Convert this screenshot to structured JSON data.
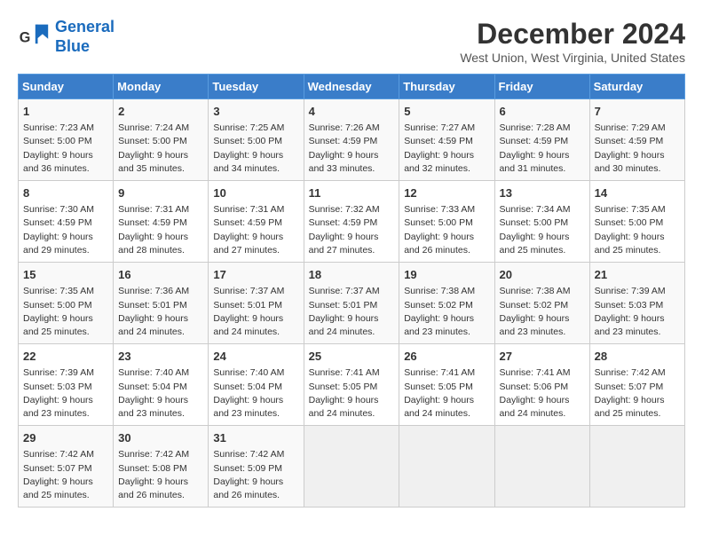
{
  "logo": {
    "line1": "General",
    "line2": "Blue"
  },
  "title": "December 2024",
  "location": "West Union, West Virginia, United States",
  "days_header": [
    "Sunday",
    "Monday",
    "Tuesday",
    "Wednesday",
    "Thursday",
    "Friday",
    "Saturday"
  ],
  "weeks": [
    [
      {
        "day": "1",
        "info": "Sunrise: 7:23 AM\nSunset: 5:00 PM\nDaylight: 9 hours\nand 36 minutes."
      },
      {
        "day": "2",
        "info": "Sunrise: 7:24 AM\nSunset: 5:00 PM\nDaylight: 9 hours\nand 35 minutes."
      },
      {
        "day": "3",
        "info": "Sunrise: 7:25 AM\nSunset: 5:00 PM\nDaylight: 9 hours\nand 34 minutes."
      },
      {
        "day": "4",
        "info": "Sunrise: 7:26 AM\nSunset: 4:59 PM\nDaylight: 9 hours\nand 33 minutes."
      },
      {
        "day": "5",
        "info": "Sunrise: 7:27 AM\nSunset: 4:59 PM\nDaylight: 9 hours\nand 32 minutes."
      },
      {
        "day": "6",
        "info": "Sunrise: 7:28 AM\nSunset: 4:59 PM\nDaylight: 9 hours\nand 31 minutes."
      },
      {
        "day": "7",
        "info": "Sunrise: 7:29 AM\nSunset: 4:59 PM\nDaylight: 9 hours\nand 30 minutes."
      }
    ],
    [
      {
        "day": "8",
        "info": "Sunrise: 7:30 AM\nSunset: 4:59 PM\nDaylight: 9 hours\nand 29 minutes."
      },
      {
        "day": "9",
        "info": "Sunrise: 7:31 AM\nSunset: 4:59 PM\nDaylight: 9 hours\nand 28 minutes."
      },
      {
        "day": "10",
        "info": "Sunrise: 7:31 AM\nSunset: 4:59 PM\nDaylight: 9 hours\nand 27 minutes."
      },
      {
        "day": "11",
        "info": "Sunrise: 7:32 AM\nSunset: 4:59 PM\nDaylight: 9 hours\nand 27 minutes."
      },
      {
        "day": "12",
        "info": "Sunrise: 7:33 AM\nSunset: 5:00 PM\nDaylight: 9 hours\nand 26 minutes."
      },
      {
        "day": "13",
        "info": "Sunrise: 7:34 AM\nSunset: 5:00 PM\nDaylight: 9 hours\nand 25 minutes."
      },
      {
        "day": "14",
        "info": "Sunrise: 7:35 AM\nSunset: 5:00 PM\nDaylight: 9 hours\nand 25 minutes."
      }
    ],
    [
      {
        "day": "15",
        "info": "Sunrise: 7:35 AM\nSunset: 5:00 PM\nDaylight: 9 hours\nand 25 minutes."
      },
      {
        "day": "16",
        "info": "Sunrise: 7:36 AM\nSunset: 5:01 PM\nDaylight: 9 hours\nand 24 minutes."
      },
      {
        "day": "17",
        "info": "Sunrise: 7:37 AM\nSunset: 5:01 PM\nDaylight: 9 hours\nand 24 minutes."
      },
      {
        "day": "18",
        "info": "Sunrise: 7:37 AM\nSunset: 5:01 PM\nDaylight: 9 hours\nand 24 minutes."
      },
      {
        "day": "19",
        "info": "Sunrise: 7:38 AM\nSunset: 5:02 PM\nDaylight: 9 hours\nand 23 minutes."
      },
      {
        "day": "20",
        "info": "Sunrise: 7:38 AM\nSunset: 5:02 PM\nDaylight: 9 hours\nand 23 minutes."
      },
      {
        "day": "21",
        "info": "Sunrise: 7:39 AM\nSunset: 5:03 PM\nDaylight: 9 hours\nand 23 minutes."
      }
    ],
    [
      {
        "day": "22",
        "info": "Sunrise: 7:39 AM\nSunset: 5:03 PM\nDaylight: 9 hours\nand 23 minutes."
      },
      {
        "day": "23",
        "info": "Sunrise: 7:40 AM\nSunset: 5:04 PM\nDaylight: 9 hours\nand 23 minutes."
      },
      {
        "day": "24",
        "info": "Sunrise: 7:40 AM\nSunset: 5:04 PM\nDaylight: 9 hours\nand 23 minutes."
      },
      {
        "day": "25",
        "info": "Sunrise: 7:41 AM\nSunset: 5:05 PM\nDaylight: 9 hours\nand 24 minutes."
      },
      {
        "day": "26",
        "info": "Sunrise: 7:41 AM\nSunset: 5:05 PM\nDaylight: 9 hours\nand 24 minutes."
      },
      {
        "day": "27",
        "info": "Sunrise: 7:41 AM\nSunset: 5:06 PM\nDaylight: 9 hours\nand 24 minutes."
      },
      {
        "day": "28",
        "info": "Sunrise: 7:42 AM\nSunset: 5:07 PM\nDaylight: 9 hours\nand 25 minutes."
      }
    ],
    [
      {
        "day": "29",
        "info": "Sunrise: 7:42 AM\nSunset: 5:07 PM\nDaylight: 9 hours\nand 25 minutes."
      },
      {
        "day": "30",
        "info": "Sunrise: 7:42 AM\nSunset: 5:08 PM\nDaylight: 9 hours\nand 26 minutes."
      },
      {
        "day": "31",
        "info": "Sunrise: 7:42 AM\nSunset: 5:09 PM\nDaylight: 9 hours\nand 26 minutes."
      },
      null,
      null,
      null,
      null
    ]
  ]
}
